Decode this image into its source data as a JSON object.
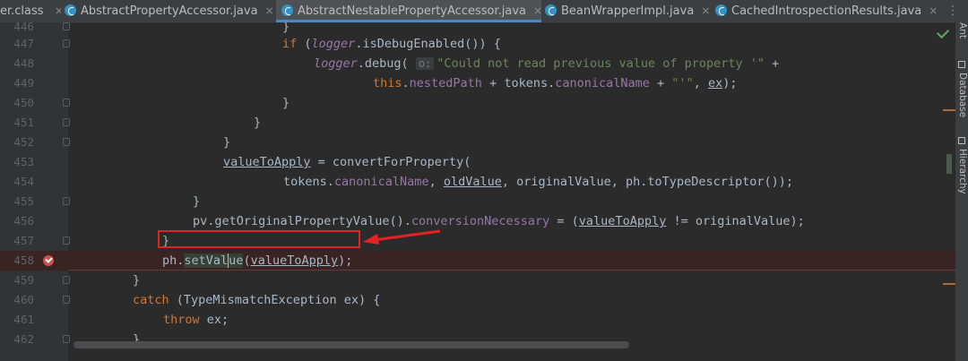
{
  "tabs": [
    {
      "label": "er.class",
      "active": false,
      "has_icon": false
    },
    {
      "label": "AbstractPropertyAccessor.java",
      "active": false,
      "has_icon": true
    },
    {
      "label": "AbstractNestablePropertyAccessor.java",
      "active": true,
      "has_icon": true
    },
    {
      "label": "BeanWrapperImpl.java",
      "active": false,
      "has_icon": true
    },
    {
      "label": "CachedIntrospectionResults.java",
      "active": false,
      "has_icon": true
    }
  ],
  "tab_close": "×",
  "tab_overflow": "⋮",
  "right_tools": [
    "Ant",
    "Database",
    "Hierarchy"
  ],
  "lines": [
    {
      "num": "446",
      "code": "}"
    },
    {
      "num": "447",
      "code": "if (logger.isDebugEnabled()) {"
    },
    {
      "num": "448",
      "code": "logger.debug( o: \"Could not read previous value of property '\" +"
    },
    {
      "num": "449",
      "code": "this.nestedPath + tokens.canonicalName + \"'\", ex);"
    },
    {
      "num": "450",
      "code": "}"
    },
    {
      "num": "451",
      "code": "}"
    },
    {
      "num": "452",
      "code": "}"
    },
    {
      "num": "453",
      "code": "valueToApply = convertForProperty("
    },
    {
      "num": "454",
      "code": "tokens.canonicalName, oldValue, originalValue, ph.toTypeDescriptor());"
    },
    {
      "num": "455",
      "code": "}"
    },
    {
      "num": "456",
      "code": "pv.getOriginalPropertyValue().conversionNecessary = (valueToApply != originalValue);"
    },
    {
      "num": "457",
      "code": "}"
    },
    {
      "num": "458",
      "code": "ph.setValue(valueToApply);",
      "breakpoint": true
    },
    {
      "num": "459",
      "code": "}"
    },
    {
      "num": "460",
      "code": "catch (TypeMismatchException ex) {"
    },
    {
      "num": "461",
      "code": "throw ex;"
    },
    {
      "num": "462",
      "code": "}"
    }
  ],
  "colors": {
    "keyword": "#cc7832",
    "field": "#9876aa",
    "string": "#6a8759",
    "text": "#a9b7c6",
    "breakpoint": "#c75450",
    "annotation": "#e52222"
  }
}
